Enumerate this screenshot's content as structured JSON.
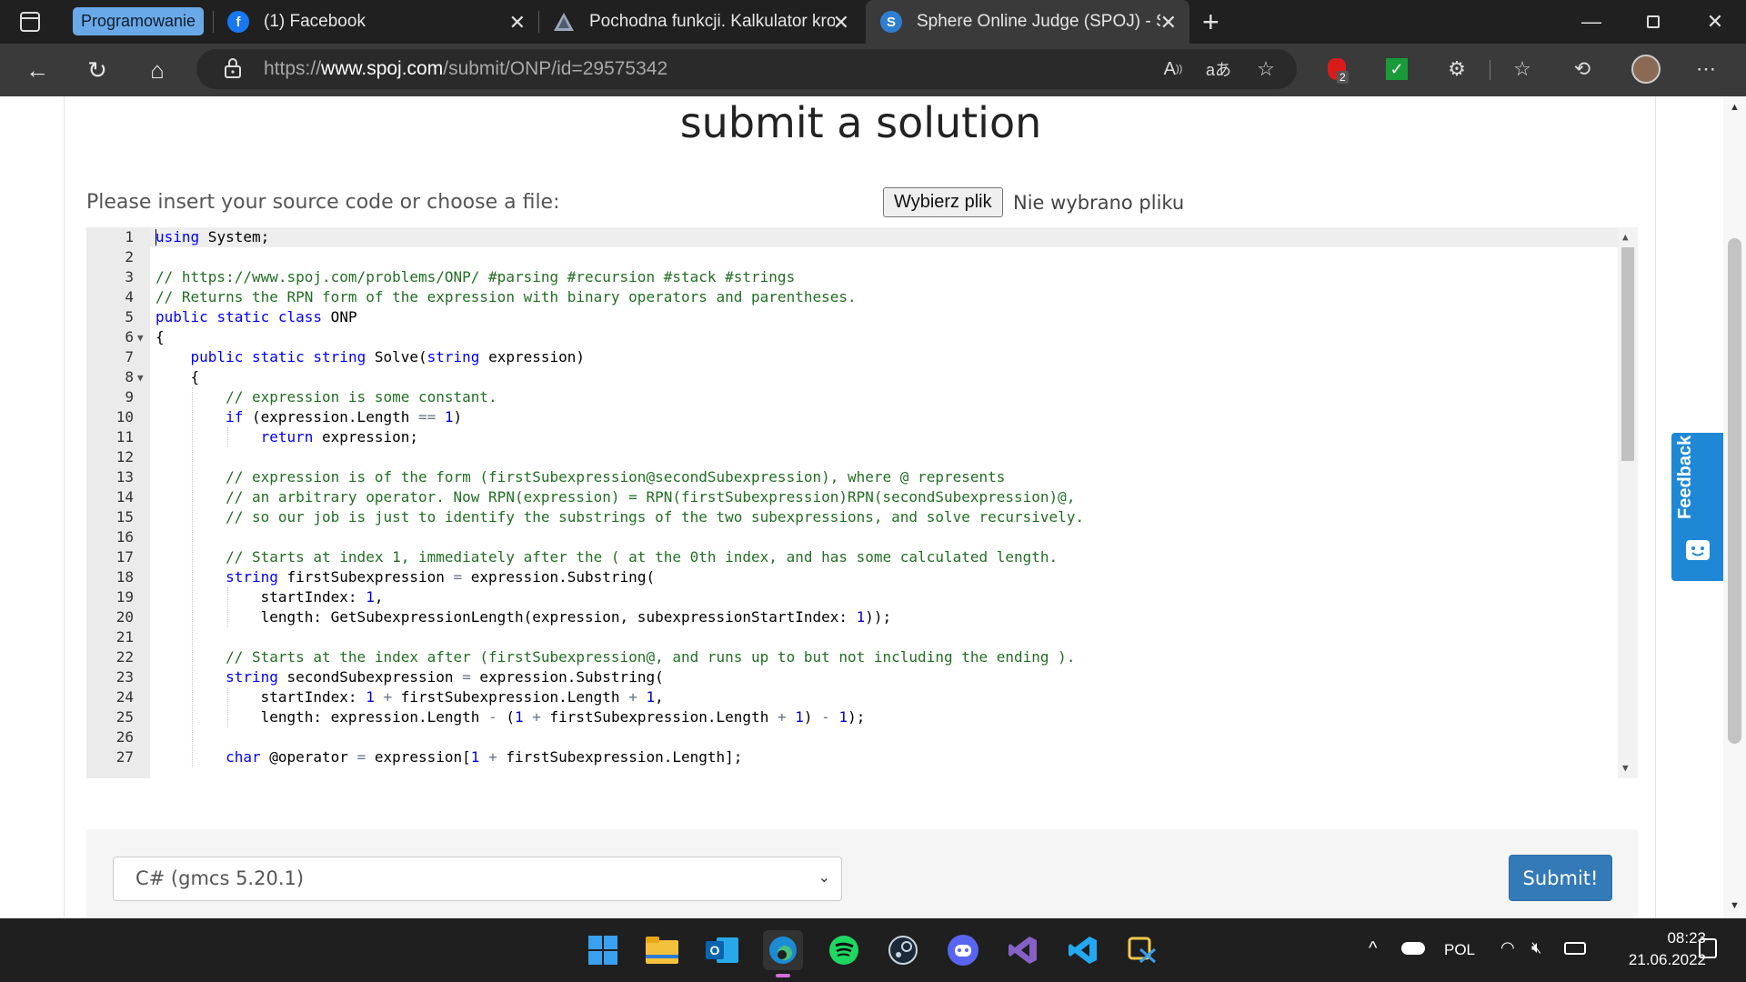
{
  "browser": {
    "tab_group": "Programowanie",
    "tabs": [
      {
        "title": "(1) Facebook",
        "icon": "facebook-icon"
      },
      {
        "title": "Pochodna funkcji. Kalkulator krok",
        "icon": "calculator-site-icon"
      },
      {
        "title": "Sphere Online Judge (SPOJ) - Su",
        "icon": "spoj-icon"
      }
    ],
    "url_scheme": "https://",
    "url_host": "www.spoj.com",
    "url_path": "/submit/ONP/id=29575342",
    "ext_badge": "2"
  },
  "page": {
    "title": "submit a solution",
    "instruction": "Please insert your source code or choose a file:",
    "file_button": "Wybierz plik",
    "file_status": "Nie wybrano pliku",
    "language": "C# (gmcs 5.20.1)",
    "submit_label": "Submit!",
    "feedback_label": "Feedback"
  },
  "code_lines": [
    "using System;",
    "",
    "// https://www.spoj.com/problems/ONP/ #parsing #recursion #stack #strings",
    "// Returns the RPN form of the expression with binary operators and parentheses.",
    "public static class ONP",
    "{",
    "    public static string Solve(string expression)",
    "    {",
    "        // expression is some constant.",
    "        if (expression.Length == 1)",
    "            return expression;",
    "",
    "        // expression is of the form (firstSubexpression@secondSubexpression), where @ represents",
    "        // an arbitrary operator. Now RPN(expression) = RPN(firstSubexpression)RPN(secondSubexpression)@,",
    "        // so our job is just to identify the substrings of the two subexpressions, and solve recursively.",
    "",
    "        // Starts at index 1, immediately after the ( at the 0th index, and has some calculated length.",
    "        string firstSubexpression = expression.Substring(",
    "            startIndex: 1,",
    "            length: GetSubexpressionLength(expression, subexpressionStartIndex: 1));",
    "",
    "        // Starts at the index after (firstSubexpression@, and runs up to but not including the ending ).",
    "        string secondSubexpression = expression.Substring(",
    "            startIndex: 1 + firstSubexpression.Length + 1,",
    "            length: expression.Length - (1 + firstSubexpression.Length + 1) - 1);",
    "",
    "        char @operator = expression[1 + firstSubexpression.Length];"
  ],
  "fold_lines": [
    6,
    8
  ],
  "taskbar": {
    "apps": [
      "windows-start-icon",
      "file-explorer-icon",
      "outlook-icon",
      "edge-icon",
      "spotify-icon",
      "steam-icon",
      "discord-icon",
      "visual-studio-icon",
      "vscode-icon",
      "snipping-tool-icon"
    ],
    "language": "POL",
    "time": "08:23",
    "date": "21.06.2022"
  },
  "colors": {
    "keyword": "#0000ff",
    "comment": "#236e24",
    "number": "#0000cd",
    "submit": "#337ab7",
    "feedback": "#1e88d6"
  }
}
